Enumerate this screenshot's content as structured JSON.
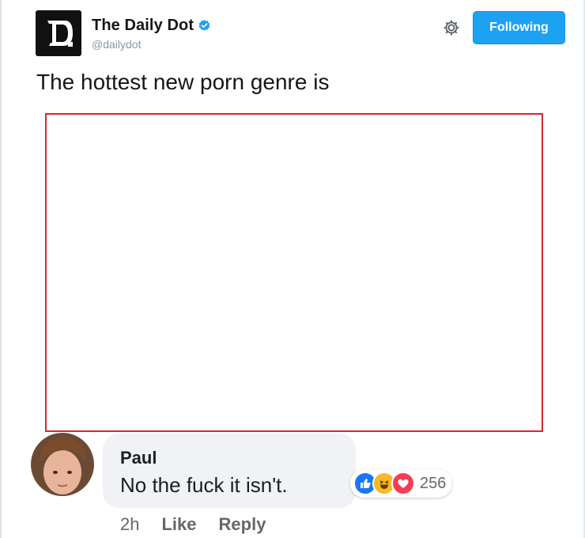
{
  "tweet": {
    "display_name": "The Daily Dot",
    "handle": "@dailydot",
    "text": "The hottest new porn genre is",
    "follow_button_label": "Following",
    "icons": {
      "logo": "daily-dot-logo",
      "verified": "verified-badge-icon",
      "gear": "gear-icon"
    },
    "colors": {
      "follow_bg": "#1da1f2",
      "verified": "#1da1f2",
      "redaction_border": "#d12a2a"
    }
  },
  "comment": {
    "author": "Paul",
    "text": "No the fuck it isn't.",
    "reactions": {
      "icons": [
        "like-reaction-icon",
        "haha-reaction-icon",
        "love-reaction-icon"
      ],
      "count": "256"
    },
    "time": "2h",
    "like_label": "Like",
    "reply_label": "Reply"
  }
}
